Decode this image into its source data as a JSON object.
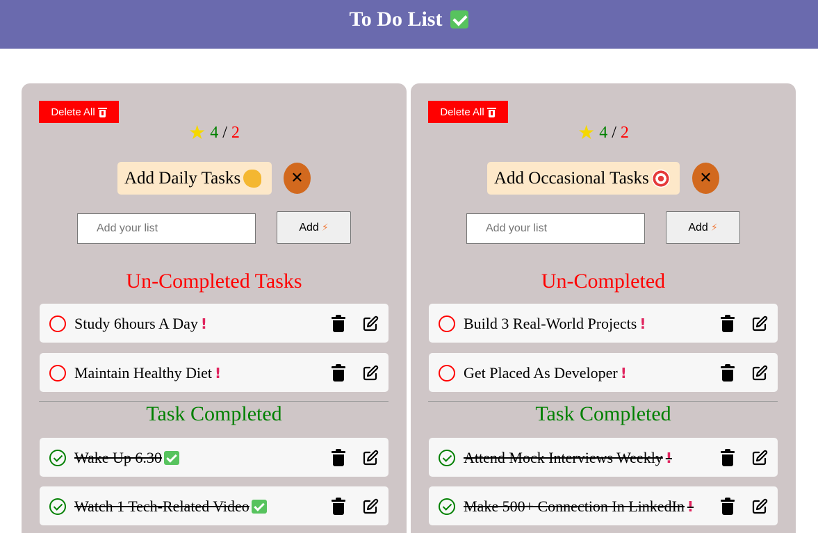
{
  "header": {
    "title": "To Do List",
    "title_icon": "check-box-icon"
  },
  "cards": [
    {
      "delete_all_label": "Delete All",
      "score": {
        "done": "4",
        "separator": "/",
        "pending": "2"
      },
      "mode_label": "Add Daily Tasks",
      "mode_icon": "flexed-biceps-icon",
      "input_placeholder": "Add your list",
      "add_label": "Add",
      "uncompleted_title": "Un-Completed Tasks",
      "uncompleted": [
        {
          "text": "Study 6hours A Day"
        },
        {
          "text": "Maintain Healthy Diet"
        }
      ],
      "completed_title": "Task Completed",
      "completed": [
        {
          "text": "Wake Up 6.30"
        },
        {
          "text": "Watch 1 Tech-Related Video"
        }
      ]
    },
    {
      "delete_all_label": "Delete All",
      "score": {
        "done": "4",
        "separator": "/",
        "pending": "2"
      },
      "mode_label": "Add Occasional Tasks",
      "mode_icon": "target-icon",
      "input_placeholder": "Add your list",
      "add_label": "Add",
      "uncompleted_title": "Un-Completed",
      "uncompleted": [
        {
          "text": "Build 3 Real-World Projects"
        },
        {
          "text": "Get Placed As Developer"
        }
      ],
      "completed_title": "Task Completed",
      "completed": [
        {
          "text": "Attend Mock Interviews Weekly"
        },
        {
          "text": "Make 500+ Connection In LinkedIn"
        }
      ]
    }
  ],
  "colors": {
    "header_bg": "#6a6aae",
    "card_bg": "#cfc6c7",
    "delete_bg": "#ff0000",
    "close_bg": "#d2691e",
    "uncompleted": "#ff0000",
    "completed": "#008000"
  }
}
